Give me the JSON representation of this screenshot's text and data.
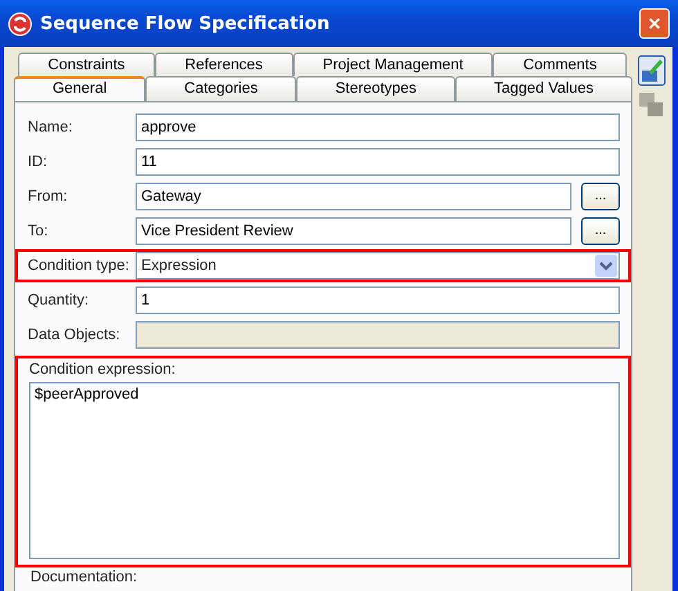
{
  "window": {
    "title": "Sequence Flow Specification"
  },
  "tabs_back": [
    {
      "label": "Constraints",
      "selected": false
    },
    {
      "label": "References",
      "selected": false
    },
    {
      "label": "Project Management",
      "selected": false
    },
    {
      "label": "Comments",
      "selected": false
    }
  ],
  "tabs_front": [
    {
      "label": "General",
      "selected": true
    },
    {
      "label": "Categories",
      "selected": false
    },
    {
      "label": "Stereotypes",
      "selected": false
    },
    {
      "label": "Tagged Values",
      "selected": false
    }
  ],
  "fields": [
    {
      "kind": "text",
      "label": "Name:",
      "value": "approve",
      "highlighted": false
    },
    {
      "kind": "text",
      "label": "ID:",
      "value": "11",
      "highlighted": false
    },
    {
      "kind": "browse",
      "label": "From:",
      "value": "Gateway",
      "button": "...",
      "highlighted": false
    },
    {
      "kind": "browse",
      "label": "To:",
      "value": "Vice President Review",
      "button": "...",
      "highlighted": false
    },
    {
      "kind": "combo",
      "label": "Condition type:",
      "value": "Expression",
      "highlighted": true
    },
    {
      "kind": "text",
      "label": "Quantity:",
      "value": "1",
      "highlighted": false
    },
    {
      "kind": "disabled",
      "label": "Data Objects:",
      "highlighted": false
    }
  ],
  "condition_expression": {
    "label": "Condition expression:",
    "value": "$peerApproved",
    "highlighted": true
  },
  "documentation": {
    "label": "Documentation:"
  }
}
